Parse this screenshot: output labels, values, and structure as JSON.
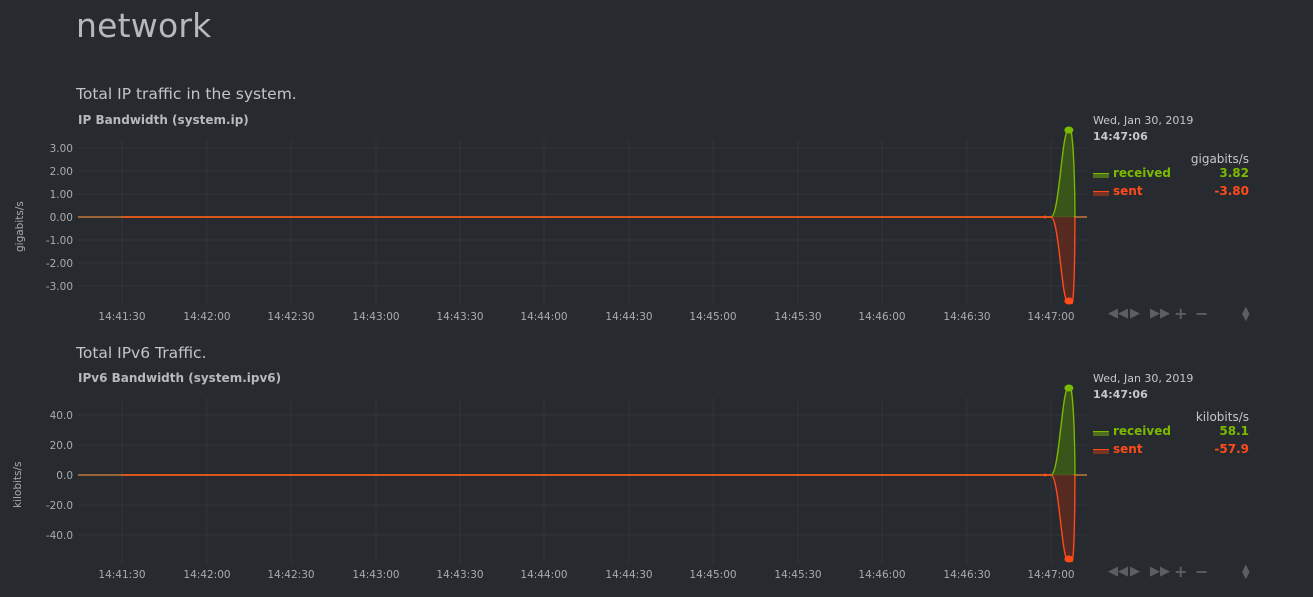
{
  "section": {
    "title": "network"
  },
  "charts": [
    {
      "description": "Total IP traffic in the system.",
      "title": "IP Bandwidth (system.ip)",
      "units": "gigabits/s",
      "legend": {
        "date": "Wed, Jan 30, 2019",
        "time": "14:47:06",
        "units": "gigabits/s",
        "received": {
          "label": "received",
          "value": "3.82"
        },
        "sent": {
          "label": "sent",
          "value": "-3.80"
        }
      },
      "y_ticks": [
        "3.00",
        "2.00",
        "1.00",
        "0.00",
        "-1.00",
        "-2.00",
        "-3.00"
      ],
      "x_ticks": [
        "14:41:30",
        "14:42:00",
        "14:42:30",
        "14:43:00",
        "14:43:30",
        "14:44:00",
        "14:44:30",
        "14:45:00",
        "14:45:30",
        "14:46:00",
        "14:46:30",
        "14:47:00"
      ]
    },
    {
      "description": "Total IPv6 Traffic.",
      "title": "IPv6 Bandwidth (system.ipv6)",
      "units": "kilobits/s",
      "legend": {
        "date": "Wed, Jan 30, 2019",
        "time": "14:47:06",
        "units": "kilobits/s",
        "received": {
          "label": "received",
          "value": "58.1"
        },
        "sent": {
          "label": "sent",
          "value": "-57.9"
        }
      },
      "y_ticks": [
        "40.0",
        "20.0",
        "0.0",
        "-20.0",
        "-40.0"
      ],
      "x_ticks": [
        "14:41:30",
        "14:42:00",
        "14:42:30",
        "14:43:00",
        "14:43:30",
        "14:44:00",
        "14:44:30",
        "14:45:00",
        "14:45:30",
        "14:46:00",
        "14:46:30",
        "14:47:00"
      ]
    }
  ],
  "chart_data": [
    {
      "type": "area",
      "title": "IP Bandwidth (system.ip)",
      "ylabel": "gigabits/s",
      "ylim": [
        -3.8,
        3.82
      ],
      "x": [
        "14:41:30",
        "14:47:00",
        "14:47:06"
      ],
      "series": [
        {
          "name": "received",
          "color": "#7cba00",
          "values": [
            0,
            0,
            3.82
          ]
        },
        {
          "name": "sent",
          "color": "#ff4a1a",
          "values": [
            0,
            0,
            -3.8
          ]
        }
      ]
    },
    {
      "type": "area",
      "title": "IPv6 Bandwidth (system.ipv6)",
      "ylabel": "kilobits/s",
      "ylim": [
        -57.9,
        58.1
      ],
      "x": [
        "14:41:30",
        "14:47:00",
        "14:47:06"
      ],
      "series": [
        {
          "name": "received",
          "color": "#7cba00",
          "values": [
            0,
            0,
            58.1
          ]
        },
        {
          "name": "sent",
          "color": "#ff4a1a",
          "values": [
            0,
            0,
            -57.9
          ]
        }
      ]
    }
  ],
  "colors": {
    "received": "#7cba00",
    "sent": "#ff4a1a",
    "zero_line": "#e08a3c",
    "grid": "#32363b"
  },
  "controls": [
    "rewind-icon",
    "play-icon",
    "fast-forward-icon",
    "zoom-in-icon",
    "zoom-out-icon",
    "resize-icon"
  ]
}
